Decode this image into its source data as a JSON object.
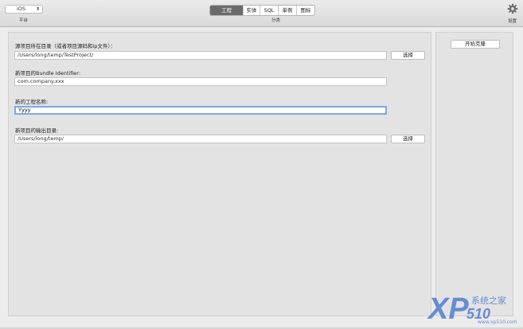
{
  "toolbar": {
    "platform": {
      "value": "iOS",
      "label": "平台"
    },
    "tabs": [
      {
        "label": "工程",
        "active": true
      },
      {
        "label": "实体",
        "active": false
      },
      {
        "label": "SQL",
        "active": false
      },
      {
        "label": "单例",
        "active": false
      },
      {
        "label": "图标",
        "active": false
      }
    ],
    "tabs_caption": "分类",
    "settings_label": "设置"
  },
  "form": {
    "source": {
      "label": "源项目所在目录（或者项目源码和ip文件）：",
      "value": "/Users/long/temp/TestProject/",
      "button": "选择"
    },
    "bundle": {
      "label": "新项目的Bundle Identifier:",
      "value": "com.company.xxx"
    },
    "name": {
      "label": "新的工程名称:",
      "value": "Yyyy"
    },
    "output": {
      "label": "新项目的输出目录:",
      "value": "/Users/long/temp/",
      "button": "选择"
    }
  },
  "side": {
    "start_button": "开始克隆"
  },
  "watermark": {
    "logo": "XP",
    "number": "510",
    "cn": "系统之家",
    "url": "www.xp510.com"
  },
  "colors": {
    "active_tab": "#6b6b6b",
    "focus_ring": "#79a8e8",
    "watermark": "#3b6fd0"
  }
}
